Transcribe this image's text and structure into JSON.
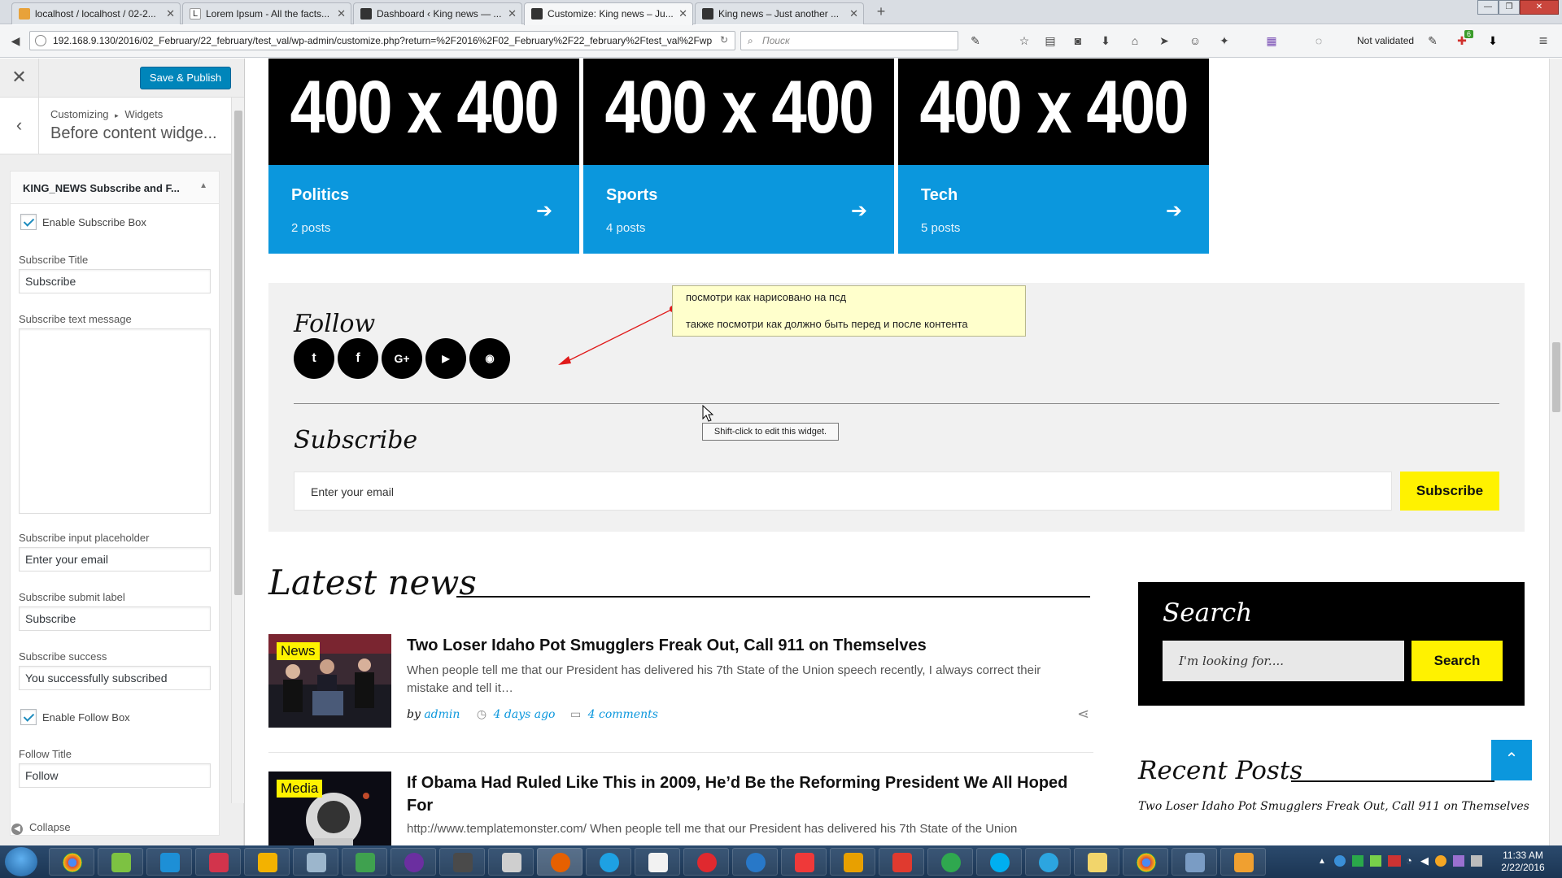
{
  "browser": {
    "tabs": [
      {
        "label": "localhost / localhost / 02-2...",
        "icon": "phpmyadmin-icon",
        "color": "#e8a23a"
      },
      {
        "label": "Lorem Ipsum - All the facts...",
        "icon": "lorem-icon",
        "color": "#ffffff"
      },
      {
        "label": "Dashboard ‹ King news — ...",
        "icon": "wordpress-icon",
        "color": "#333333"
      },
      {
        "label": "Customize: King news – Ju...",
        "icon": "wordpress-icon",
        "color": "#333333"
      },
      {
        "label": "King news – Just another ...",
        "icon": "wordpress-icon",
        "color": "#333333"
      }
    ],
    "url": "192.168.9.130/2016/02_February/22_february/test_val/wp-admin/customize.php?return=%2F2016%2F02_February%2F22_february%2Ftest_val%2Fwp",
    "search_placeholder": "Поиск",
    "validation_status": "Not validated",
    "badge_count": "6"
  },
  "customizer": {
    "save_label": "Save & Publish",
    "breadcrumb_root": "Customizing",
    "breadcrumb_sep": "▸",
    "breadcrumb_leaf": "Widgets",
    "section_title": "Before content widge...",
    "widget_title": "KING_NEWS Subscribe and F...",
    "enable_subscribe_label": "Enable Subscribe Box",
    "subscribe_title_label": "Subscribe Title",
    "subscribe_title_value": "Subscribe",
    "subscribe_text_label": "Subscribe text message",
    "subscribe_text_value": "",
    "placeholder_label": "Subscribe input placeholder",
    "placeholder_value": "Enter your email",
    "submit_label_label": "Subscribe submit label",
    "submit_label_value": "Subscribe",
    "success_label": "Subscribe success",
    "success_value": "You successfully subscribed",
    "enable_follow_label": "Enable Follow Box",
    "follow_title_label": "Follow Title",
    "follow_title_value": "Follow",
    "collapse_label": "Collapse"
  },
  "preview": {
    "categories": [
      {
        "placeholder": "400 x 400",
        "name": "Politics",
        "count": "2 posts"
      },
      {
        "placeholder": "400 x 400",
        "name": "Sports",
        "count": "4 posts"
      },
      {
        "placeholder": "400 x 400",
        "name": "Tech",
        "count": "5 posts"
      }
    ],
    "follow_title": "Follow",
    "social": [
      "twitter-icon",
      "facebook-icon",
      "google-plus-icon",
      "youtube-icon",
      "rss-icon"
    ],
    "subscribe_title": "Subscribe",
    "subscribe_placeholder": "Enter your email",
    "subscribe_button": "Subscribe",
    "note_line1": "посмотри как нарисовано на псд",
    "note_line2": "также посмотри как должно быть перед и после контента",
    "tooltip": "Shift-click to edit this widget.",
    "latest_title": "Latest news",
    "posts": [
      {
        "tag": "News",
        "title": "Two Loser Idaho Pot Smugglers Freak Out, Call 911 on Themselves",
        "excerpt": "When people tell me that our President has delivered his 7th State of the Union speech recently, I always correct their mistake and tell it…",
        "by": "by",
        "author": "admin",
        "date": "4 days ago",
        "comments": "4 comments"
      },
      {
        "tag": "Media",
        "title": "If Obama Had Ruled Like This in 2009, He’d Be the Reforming President We All Hoped For",
        "excerpt": "http://www.templatemonster.com/ When people tell me that our President has delivered his 7th State of the Union"
      }
    ],
    "search_title": "Search",
    "search_placeholder": "I'm looking for....",
    "search_button": "Search",
    "recent_title": "Recent Posts",
    "recent_item": "Two Loser Idaho Pot Smugglers Freak Out, Call 911 on Themselves"
  },
  "taskbar": {
    "time": "11:33 AM",
    "date": "2/22/2016"
  }
}
